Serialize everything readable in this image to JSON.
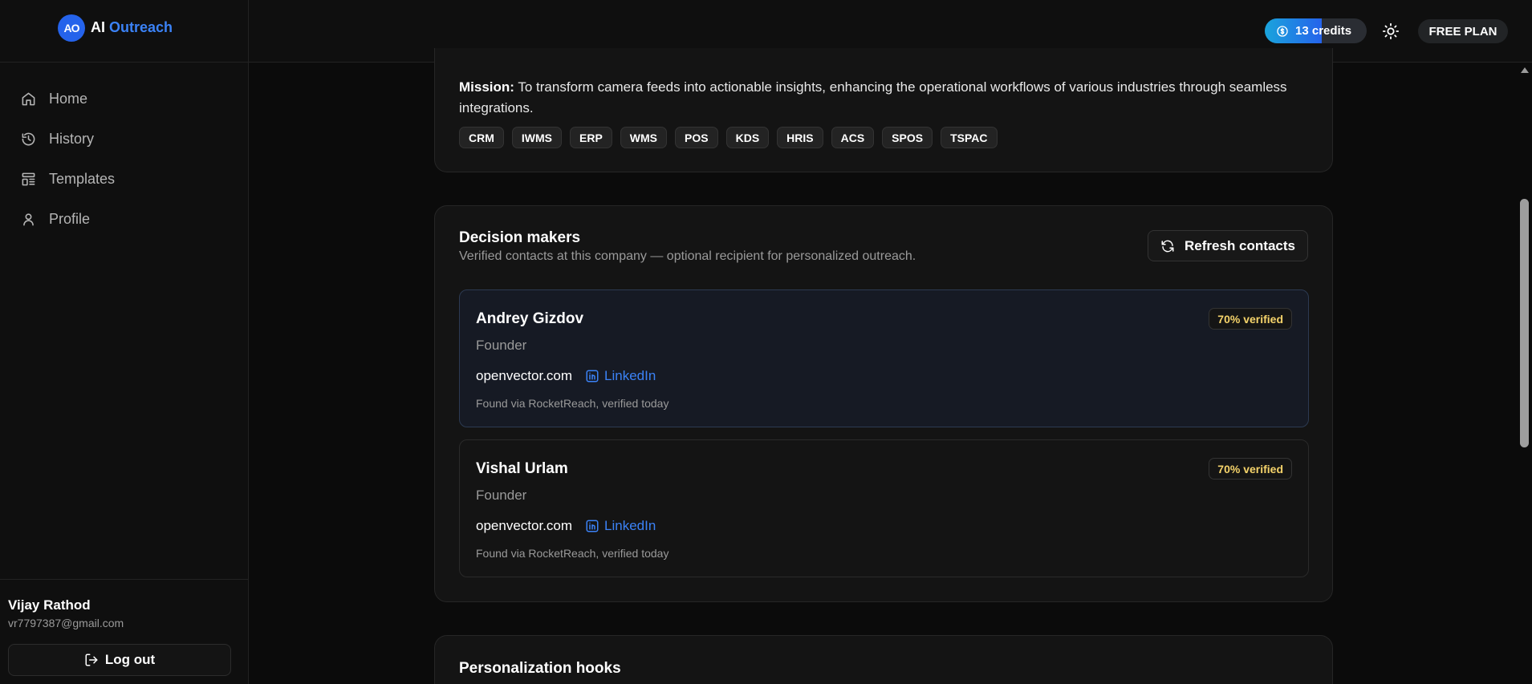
{
  "brand": {
    "logo_text": "AO",
    "name_part1": "AI",
    "name_part2": "Outreach"
  },
  "sidebar": {
    "items": [
      {
        "label": "Home",
        "icon": "home-icon"
      },
      {
        "label": "History",
        "icon": "history-icon"
      },
      {
        "label": "Templates",
        "icon": "templates-icon"
      },
      {
        "label": "Profile",
        "icon": "user-icon"
      }
    ]
  },
  "user": {
    "name": "Vijay Rathod",
    "email": "vr7797387@gmail.com",
    "logout_label": "Log out"
  },
  "topbar": {
    "credits_label": "13 credits",
    "credits_fill_fraction": 0.56,
    "plan_label": "FREE PLAN"
  },
  "mission": {
    "label": "Mission:",
    "text": "To transform camera feeds into actionable insights, enhancing the operational workflows of various industries through seamless integrations.",
    "tags": [
      "CRM",
      "IWMS",
      "ERP",
      "WMS",
      "POS",
      "KDS",
      "HRIS",
      "ACS",
      "SPOS",
      "TSPAC"
    ]
  },
  "decision_makers": {
    "title": "Decision makers",
    "subtitle": "Verified contacts at this company — optional recipient for personalized outreach.",
    "refresh_label": "Refresh contacts",
    "contacts": [
      {
        "name": "Andrey Gizdov",
        "role": "Founder",
        "domain": "openvector.com",
        "linkedin": "LinkedIn",
        "source": "Found via RocketReach, verified today",
        "badge": "70% verified"
      },
      {
        "name": "Vishal Urlam",
        "role": "Founder",
        "domain": "openvector.com",
        "linkedin": "LinkedIn",
        "source": "Found via RocketReach, verified today",
        "badge": "70% verified"
      }
    ]
  },
  "hooks": {
    "title": "Personalization hooks"
  },
  "colors": {
    "accent": "#3b82f6",
    "badge_text": "#f5d36a",
    "background": "#0b0b0b"
  }
}
